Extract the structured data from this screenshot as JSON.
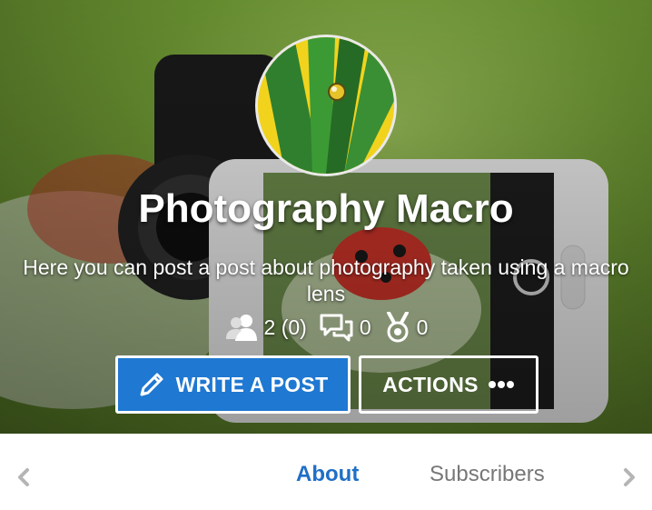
{
  "group": {
    "title": "Photography Macro",
    "description": "Here you can post a post about photography taken using a macro lens"
  },
  "stats": {
    "members": "2 (0)",
    "posts": "0",
    "awards": "0"
  },
  "buttons": {
    "write_post": "WRITE A POST",
    "actions": "ACTIONS"
  },
  "tabs": [
    {
      "label": "About",
      "active": true
    },
    {
      "label": "Subscribers",
      "active": false
    }
  ],
  "icons": {
    "members": "members-icon",
    "posts": "comments-icon",
    "awards": "medal-icon",
    "write": "pencil-icon",
    "actions": "more-dots-icon",
    "prev": "chevron-left-icon",
    "next": "chevron-right-icon"
  },
  "colors": {
    "primary": "#1f78d1",
    "active_tab": "#1f6fc6",
    "inactive_tab": "#777777"
  }
}
